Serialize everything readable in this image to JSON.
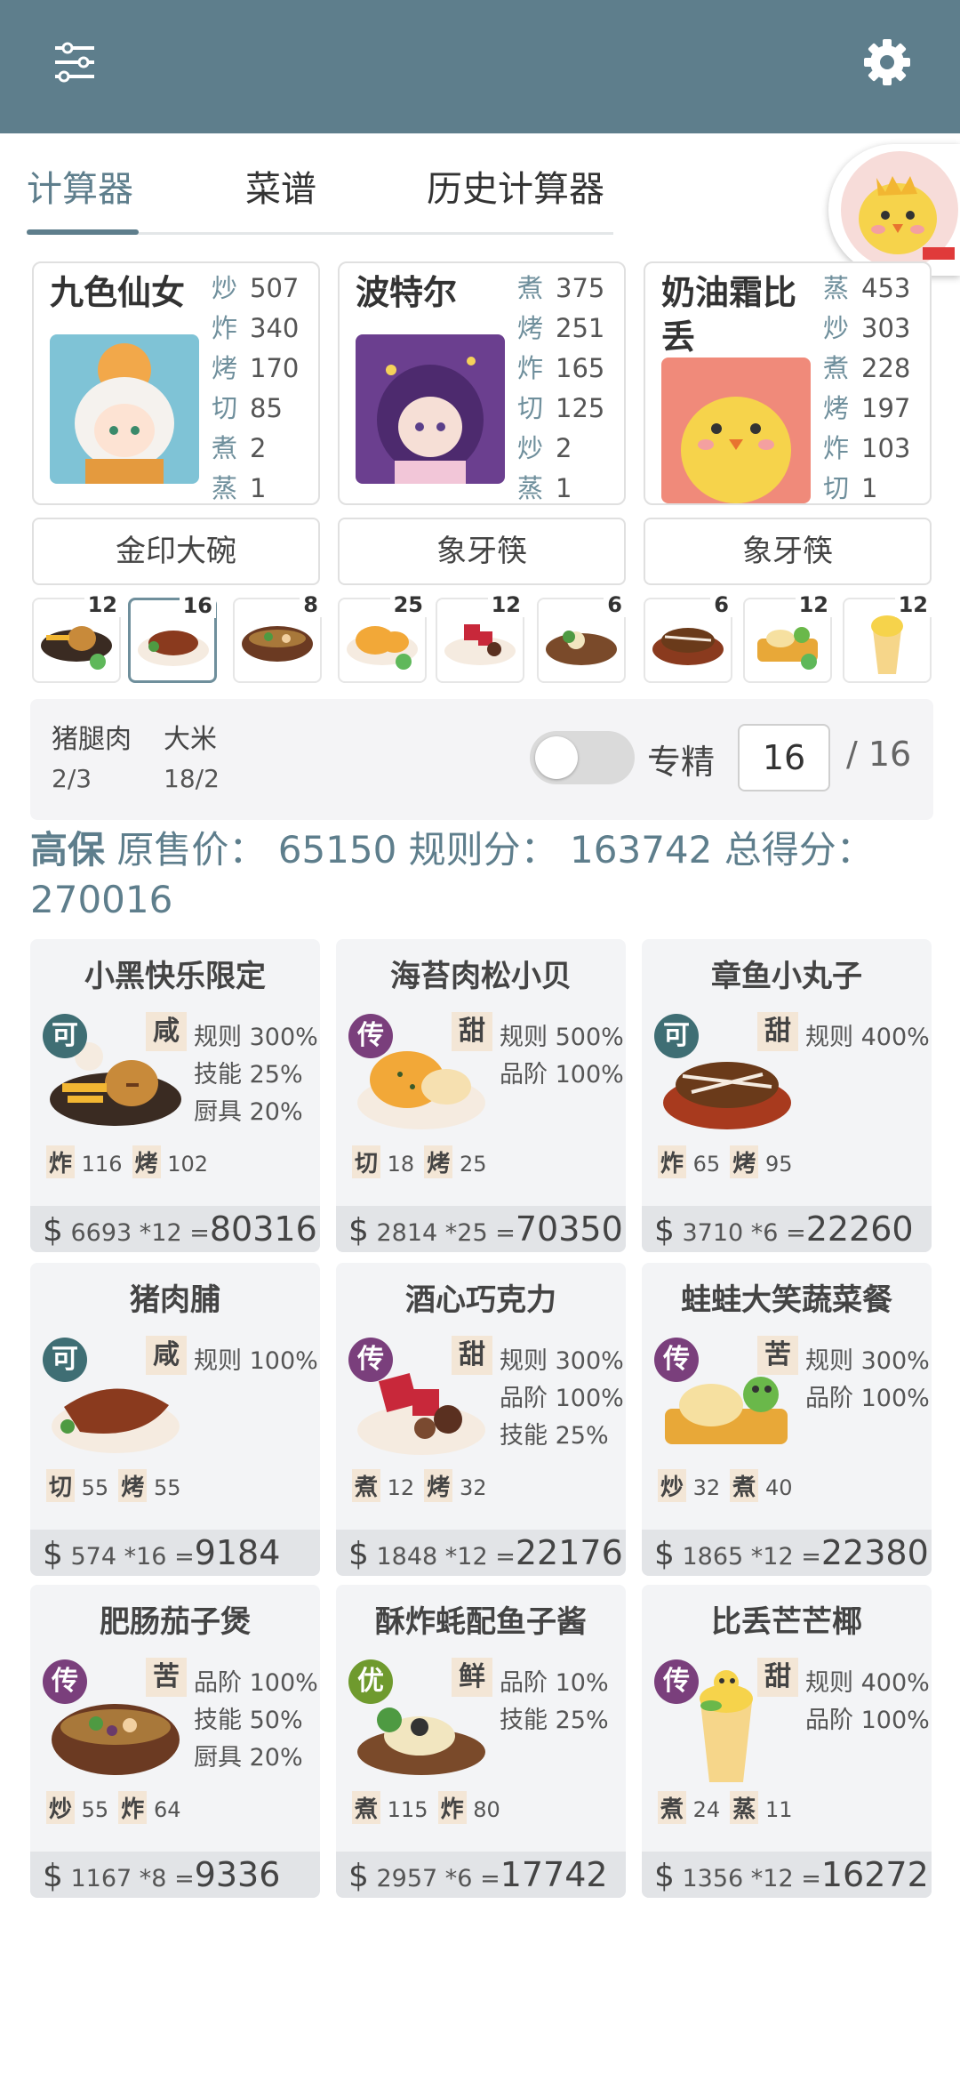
{
  "tabs": [
    "计算器",
    "菜谱",
    "历史计算器"
  ],
  "chefs": [
    {
      "name": "九色仙女",
      "stats": [
        {
          "k": "炒",
          "v": "507"
        },
        {
          "k": "炸",
          "v": "340"
        },
        {
          "k": "烤",
          "v": "170"
        },
        {
          "k": "切",
          "v": "85"
        },
        {
          "k": "煮",
          "v": "2"
        },
        {
          "k": "蒸",
          "v": "1"
        }
      ],
      "equip": "金印大碗"
    },
    {
      "name": "波特尔",
      "stats": [
        {
          "k": "煮",
          "v": "375"
        },
        {
          "k": "烤",
          "v": "251"
        },
        {
          "k": "炸",
          "v": "165"
        },
        {
          "k": "切",
          "v": "125"
        },
        {
          "k": "炒",
          "v": "2"
        },
        {
          "k": "蒸",
          "v": "1"
        }
      ],
      "equip": "象牙筷"
    },
    {
      "name": "奶油霜比丢",
      "stats": [
        {
          "k": "蒸",
          "v": "453"
        },
        {
          "k": "炒",
          "v": "303"
        },
        {
          "k": "煮",
          "v": "228"
        },
        {
          "k": "烤",
          "v": "197"
        },
        {
          "k": "炸",
          "v": "103"
        },
        {
          "k": "切",
          "v": "1"
        }
      ],
      "equip": "象牙筷"
    }
  ],
  "slot_counts": [
    "12",
    "16",
    "8",
    "25",
    "12",
    "6",
    "6",
    "12",
    "12"
  ],
  "ingredients": [
    {
      "name": "猪腿肉",
      "amount": "2/3"
    },
    {
      "name": "大米",
      "amount": "18/2"
    }
  ],
  "specialize": {
    "label": "专精",
    "value": "16",
    "total": "/ 16",
    "enabled": false
  },
  "summary": {
    "grade": "高保",
    "text": "原售价：  65150 规则分：  163742 总得分：",
    "total": "270016"
  },
  "dishes": [
    {
      "title": "小黑快乐限定",
      "badge": "可",
      "badge_color": "#3f6e74",
      "taste": "咸",
      "buffs": [
        "规则 300%",
        "技能 25%",
        "厨具 20%"
      ],
      "skills": [
        {
          "k": "炸",
          "v": "116"
        },
        {
          "k": "烤",
          "v": "102"
        }
      ],
      "price": "6693 *12",
      "eq": "=",
      "total": "80316"
    },
    {
      "title": "海苔肉松小贝",
      "badge": "传",
      "badge_color": "#7a3f7c",
      "taste": "甜",
      "buffs": [
        "规则 500%",
        "品阶 100%"
      ],
      "skills": [
        {
          "k": "切",
          "v": "18"
        },
        {
          "k": "烤",
          "v": "25"
        }
      ],
      "price": "2814 *25",
      "eq": "=",
      "total": "70350"
    },
    {
      "title": "章鱼小丸子",
      "badge": "可",
      "badge_color": "#3f6e74",
      "taste": "甜",
      "buffs": [
        "规则 400%"
      ],
      "skills": [
        {
          "k": "炸",
          "v": "65"
        },
        {
          "k": "烤",
          "v": "95"
        }
      ],
      "price": "3710 *6",
      "eq": "=",
      "total": "22260"
    },
    {
      "title": "猪肉脯",
      "badge": "可",
      "badge_color": "#3f6e74",
      "taste": "咸",
      "buffs": [
        "规则 100%"
      ],
      "skills": [
        {
          "k": "切",
          "v": "55"
        },
        {
          "k": "烤",
          "v": "55"
        }
      ],
      "price": "574 *16",
      "eq": "=",
      "total": "9184"
    },
    {
      "title": "酒心巧克力",
      "badge": "传",
      "badge_color": "#7a3f7c",
      "taste": "甜",
      "buffs": [
        "规则 300%",
        "品阶 100%",
        "技能 25%"
      ],
      "skills": [
        {
          "k": "煮",
          "v": "12"
        },
        {
          "k": "烤",
          "v": "32"
        }
      ],
      "price": "1848 *12",
      "eq": "=",
      "total": "22176"
    },
    {
      "title": "蛙蛙大笑蔬菜餐",
      "badge": "传",
      "badge_color": "#7a3f7c",
      "taste": "苦",
      "buffs": [
        "规则 300%",
        "品阶 100%"
      ],
      "skills": [
        {
          "k": "炒",
          "v": "32"
        },
        {
          "k": "煮",
          "v": "40"
        }
      ],
      "price": "1865 *12",
      "eq": "=",
      "total": "22380"
    },
    {
      "title": "肥肠茄子煲",
      "badge": "传",
      "badge_color": "#7a3f7c",
      "taste": "苦",
      "buffs": [
        "品阶 100%",
        "技能 50%",
        "厨具 20%"
      ],
      "skills": [
        {
          "k": "炒",
          "v": "55"
        },
        {
          "k": "炸",
          "v": "64"
        }
      ],
      "price": "1167 *8",
      "eq": "=",
      "total": "9336"
    },
    {
      "title": "酥炸蚝配鱼子酱",
      "badge": "优",
      "badge_color": "#6f9a2e",
      "taste": "鲜",
      "buffs": [
        "品阶 10%",
        "技能 25%"
      ],
      "skills": [
        {
          "k": "煮",
          "v": "115"
        },
        {
          "k": "炸",
          "v": "80"
        }
      ],
      "price": "2957 *6",
      "eq": "=",
      "total": "17742"
    },
    {
      "title": "比丢芒芒椰",
      "badge": "传",
      "badge_color": "#7a3f7c",
      "taste": "甜",
      "buffs": [
        "规则 400%",
        "品阶 100%"
      ],
      "skills": [
        {
          "k": "煮",
          "v": "24"
        },
        {
          "k": "蒸",
          "v": "11"
        }
      ],
      "price": "1356 *12",
      "eq": "=",
      "total": "16272"
    }
  ]
}
